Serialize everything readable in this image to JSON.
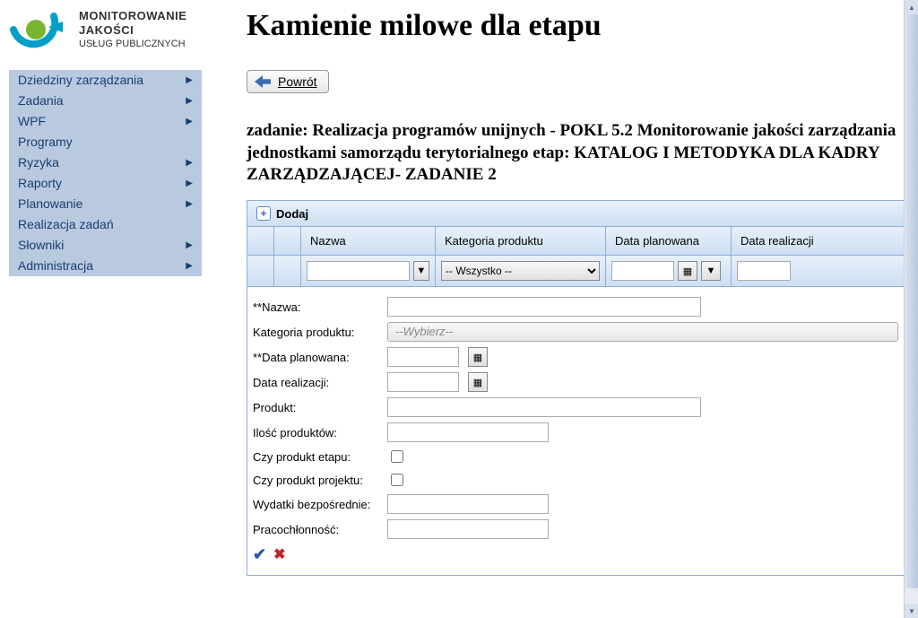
{
  "logo": {
    "line1": "MONITOROWANIE",
    "line2": "JAKOŚCI",
    "line3": "USŁUG PUBLICZNYCH"
  },
  "nav": {
    "items": [
      {
        "label": "Dziedziny zarządzania",
        "has_children": true
      },
      {
        "label": "Zadania",
        "has_children": true
      },
      {
        "label": "WPF",
        "has_children": true
      },
      {
        "label": "Programy",
        "has_children": false
      },
      {
        "label": "Ryzyka",
        "has_children": true
      },
      {
        "label": "Raporty",
        "has_children": true
      },
      {
        "label": "Planowanie",
        "has_children": true
      },
      {
        "label": "Realizacja zadań",
        "has_children": false
      },
      {
        "label": "Słowniki",
        "has_children": true
      },
      {
        "label": "Administracja",
        "has_children": true
      }
    ]
  },
  "page": {
    "title": "Kamienie milowe dla etapu",
    "back_label": "Powrót",
    "task_heading": "zadanie: Realizacja programów unijnych - POKL 5.2 Monitorowanie jakości zarządzania jednostkami samorządu terytorialnego etap: KATALOG I METODYKA DLA KADRY ZARZĄDZAJĄCEJ- ZADANIE 2"
  },
  "grid": {
    "add_label": "Dodaj",
    "columns": {
      "nazwa": "Nazwa",
      "kategoria": "Kategoria produktu",
      "data_plan": "Data planowana",
      "data_real": "Data realizacji"
    },
    "filter": {
      "all_option": "-- Wszystko --"
    }
  },
  "form": {
    "labels": {
      "nazwa": "**Nazwa:",
      "kategoria": "Kategoria produktu:",
      "data_plan": "**Data planowana:",
      "data_real": "Data realizacji:",
      "produkt": "Produkt:",
      "ilosc": "Ilość produktów:",
      "czy_etap": "Czy produkt etapu:",
      "czy_projekt": "Czy produkt projektu:",
      "wydatki": "Wydatki bezpośrednie:",
      "pracochlonnosc": "Pracochłonność:"
    },
    "kategoria_placeholder": "--Wybierz--"
  },
  "icons": {
    "funnel": "▼",
    "calendar": "▦",
    "plus": "+",
    "check": "✔",
    "cancel": "✖",
    "chevron": "▶"
  }
}
